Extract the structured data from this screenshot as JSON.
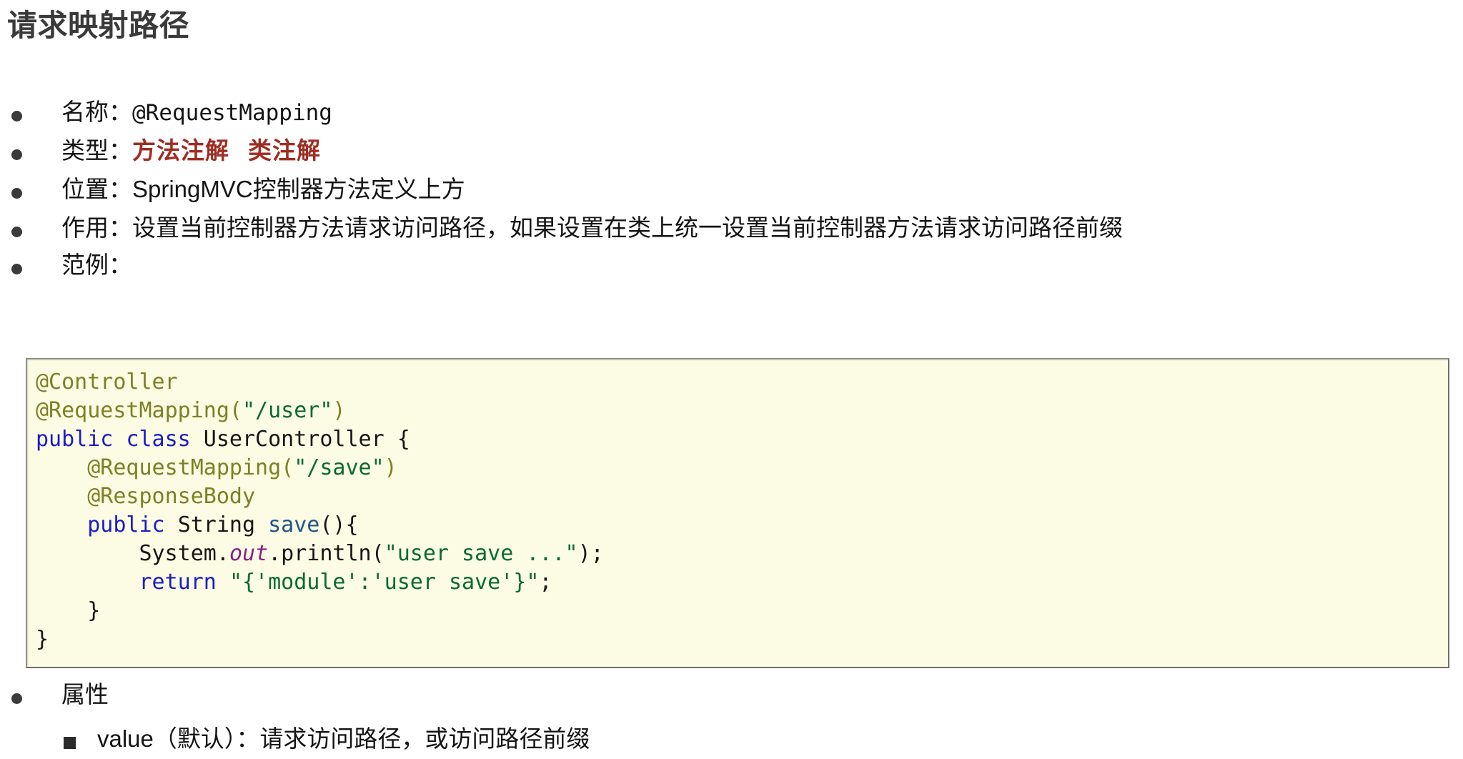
{
  "page": {
    "title": "请求映射路径",
    "background_color": "#ffffff",
    "title_color": "#3a3a3a"
  },
  "bullets": [
    {
      "id": "name",
      "label": "名称：",
      "value": "@RequestMapping",
      "value_style": "mono"
    },
    {
      "id": "type",
      "label": "类型：",
      "value_primary": "方法注解",
      "value_secondary": "类注解",
      "accent_color": "#9f2d22"
    },
    {
      "id": "position",
      "label": "位置：",
      "value": "SpringMVC控制器方法定义上方"
    },
    {
      "id": "usage",
      "label": "作用：",
      "value": "设置当前控制器方法请求访问路径，如果设置在类上统一设置当前控制器方法请求访问路径前缀"
    },
    {
      "id": "example",
      "label": "范例：",
      "value": ""
    }
  ],
  "code_block": {
    "background_color": "#fcfce4",
    "border_color": "#8e8e84",
    "lines": [
      [
        {
          "t": "@Controller",
          "c": "ann"
        }
      ],
      [
        {
          "t": "@RequestMapping(",
          "c": "ann"
        },
        {
          "t": "\"/user\"",
          "c": "str"
        },
        {
          "t": ")",
          "c": "ann"
        }
      ],
      [
        {
          "t": "public",
          "c": "kw"
        },
        {
          "t": " ",
          "c": "plain"
        },
        {
          "t": "class",
          "c": "kw"
        },
        {
          "t": " UserController {",
          "c": "plain"
        }
      ],
      [
        {
          "t": "    @RequestMapping(",
          "c": "ann"
        },
        {
          "t": "\"/save\"",
          "c": "str"
        },
        {
          "t": ")",
          "c": "ann"
        }
      ],
      [
        {
          "t": "    @ResponseBody",
          "c": "ann"
        }
      ],
      [
        {
          "t": "    ",
          "c": "plain"
        },
        {
          "t": "public",
          "c": "kw"
        },
        {
          "t": " ",
          "c": "plain"
        },
        {
          "t": "String",
          "c": "type"
        },
        {
          "t": " ",
          "c": "plain"
        },
        {
          "t": "save",
          "c": "meth"
        },
        {
          "t": "(){",
          "c": "plain"
        }
      ],
      [
        {
          "t": "        System.",
          "c": "plain"
        },
        {
          "t": "out",
          "c": "field"
        },
        {
          "t": ".println(",
          "c": "plain"
        },
        {
          "t": "\"user save ...\"",
          "c": "str"
        },
        {
          "t": ");",
          "c": "plain"
        }
      ],
      [
        {
          "t": "        ",
          "c": "plain"
        },
        {
          "t": "return",
          "c": "kw"
        },
        {
          "t": " ",
          "c": "plain"
        },
        {
          "t": "\"{'module':'user save'}\"",
          "c": "str"
        },
        {
          "t": ";",
          "c": "plain"
        }
      ],
      [
        {
          "t": "    }",
          "c": "plain"
        }
      ],
      [
        {
          "t": "}",
          "c": "plain"
        }
      ]
    ]
  },
  "attributes": {
    "heading": "属性",
    "items": [
      {
        "text": "value（默认）：请求访问路径，或访问路径前缀"
      }
    ]
  }
}
